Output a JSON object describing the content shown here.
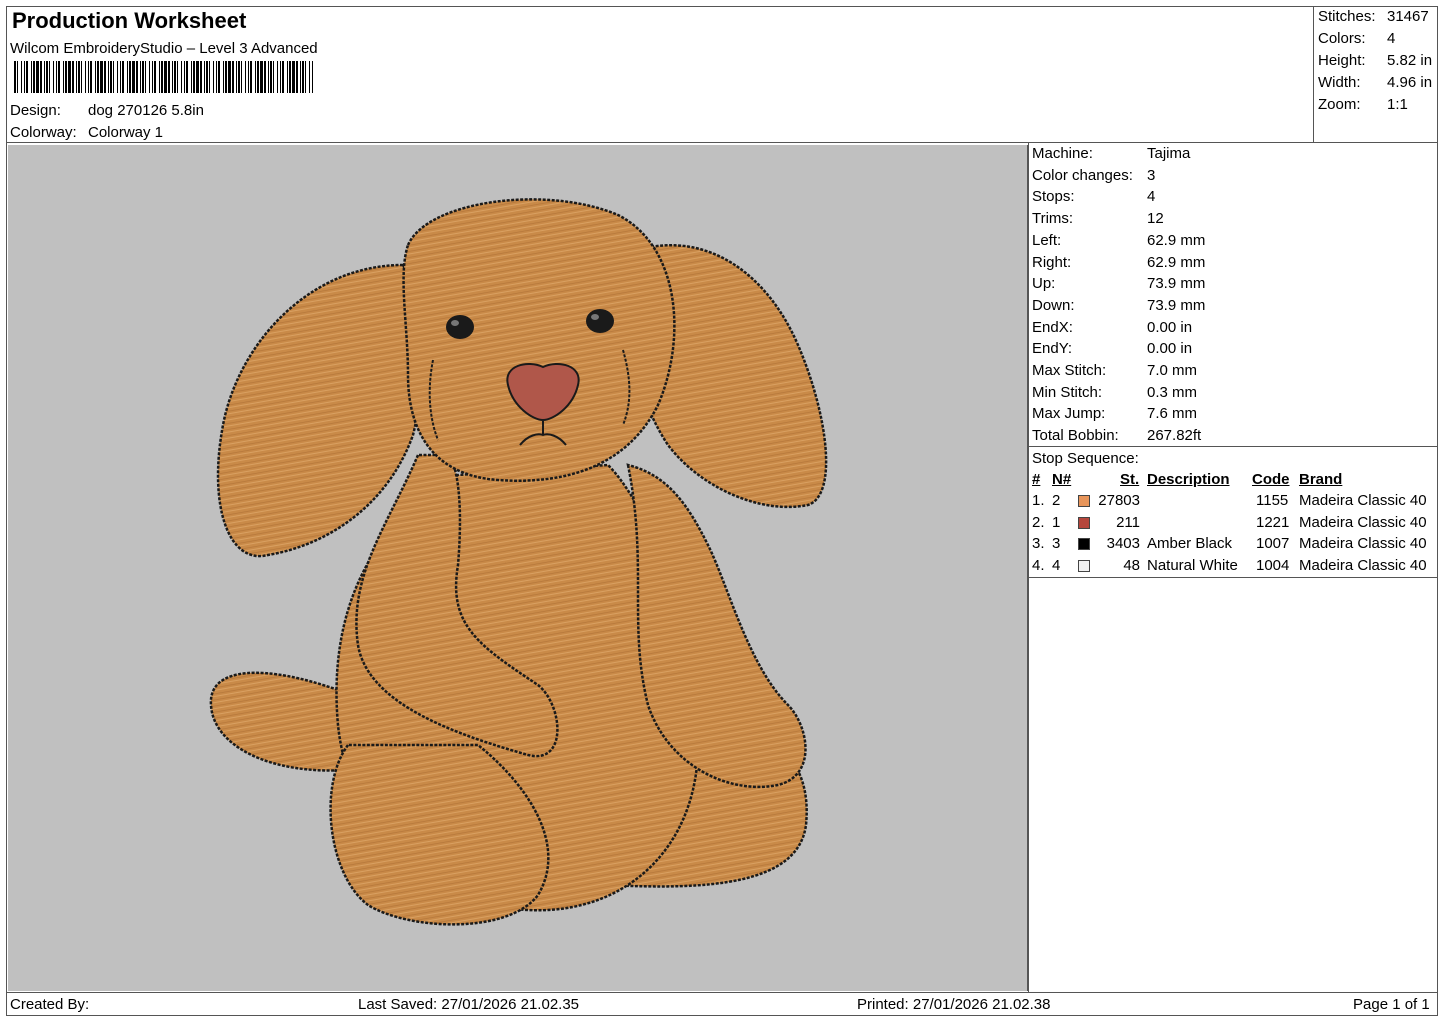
{
  "header": {
    "title": "Production Worksheet",
    "software": "Wilcom EmbroideryStudio – Level 3 Advanced",
    "design_label": "Design:",
    "design_value": "dog 270126 5.8in",
    "colorway_label": "Colorway:",
    "colorway_value": "Colorway 1"
  },
  "summary": [
    {
      "label": "Stitches:",
      "value": "31467"
    },
    {
      "label": "Colors:",
      "value": "4"
    },
    {
      "label": "Height:",
      "value": "5.82 in"
    },
    {
      "label": "Width:",
      "value": "4.96 in"
    },
    {
      "label": "Zoom:",
      "value": "1:1"
    }
  ],
  "machine_info": [
    {
      "label": "Machine:",
      "value": "Tajima"
    },
    {
      "label": "Color changes:",
      "value": "3"
    },
    {
      "label": "Stops:",
      "value": "4"
    },
    {
      "label": "Trims:",
      "value": "12"
    },
    {
      "label": "Left:",
      "value": "62.9 mm"
    },
    {
      "label": "Right:",
      "value": "62.9 mm"
    },
    {
      "label": "Up:",
      "value": "73.9 mm"
    },
    {
      "label": "Down:",
      "value": "73.9 mm"
    },
    {
      "label": "EndX:",
      "value": "0.00 in"
    },
    {
      "label": "EndY:",
      "value": "0.00 in"
    },
    {
      "label": "Max Stitch:",
      "value": "7.0 mm"
    },
    {
      "label": "Min Stitch:",
      "value": "0.3 mm"
    },
    {
      "label": "Max Jump:",
      "value": "7.6 mm"
    },
    {
      "label": "Total Bobbin:",
      "value": "267.82ft"
    }
  ],
  "stop_sequence": {
    "title": "Stop Sequence:",
    "headers": {
      "num": "#",
      "n": "N#",
      "st": "St.",
      "description": "Description",
      "code": "Code",
      "brand": "Brand"
    },
    "rows": [
      {
        "num": "1.",
        "n": "2",
        "color": "#e8955a",
        "st": "27803",
        "description": "",
        "code": "1155",
        "brand": "Madeira Classic 40"
      },
      {
        "num": "2.",
        "n": "1",
        "color": "#b5463c",
        "st": "211",
        "description": "",
        "code": "1221",
        "brand": "Madeira Classic 40"
      },
      {
        "num": "3.",
        "n": "3",
        "color": "#000000",
        "st": "3403",
        "description": "Amber Black",
        "code": "1007",
        "brand": "Madeira Classic 40"
      },
      {
        "num": "4.",
        "n": "4",
        "color": "#f2f2f2",
        "st": "48",
        "description": "Natural White",
        "code": "1004",
        "brand": "Madeira Classic 40"
      }
    ]
  },
  "footer": {
    "created_by": "Created By:",
    "last_saved": "Last Saved: 27/01/2026 21.02.35",
    "printed": "Printed: 27/01/2026 21.02.38",
    "page": "Page 1 of 1"
  },
  "colors": {
    "canvas_bg": "#c0c0c0",
    "fur": "#c98a48",
    "outline": "#1a1a1a",
    "nose": "#b0574a"
  }
}
